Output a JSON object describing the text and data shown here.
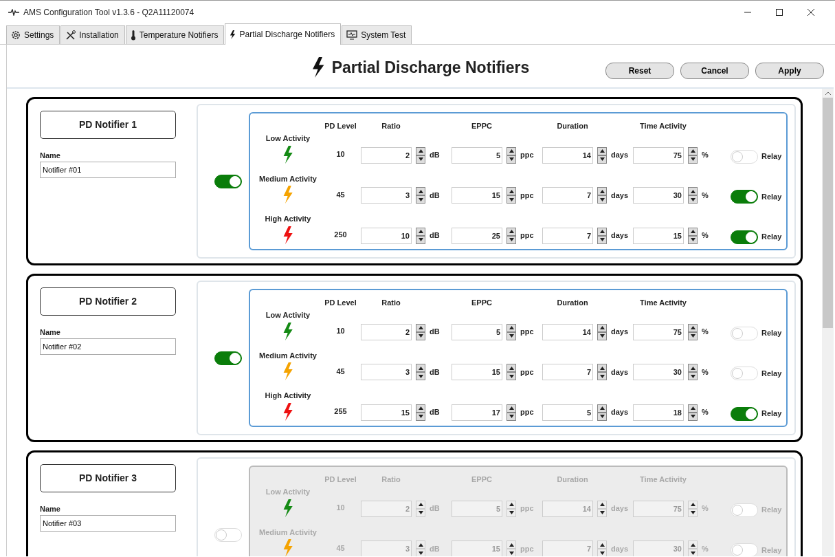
{
  "window": {
    "title": "AMS Configuration Tool v1.3.6 - Q2A11120074"
  },
  "tabs": [
    {
      "label": "Settings",
      "kind": "gear",
      "selected": false
    },
    {
      "label": "Installation",
      "kind": "tools",
      "selected": false
    },
    {
      "label": "Temperature Notifiers",
      "kind": "thermometer",
      "selected": false
    },
    {
      "label": "Partial Discharge Notifiers",
      "kind": "bolt",
      "selected": true
    },
    {
      "label": "System Test",
      "kind": "monitor",
      "selected": false
    }
  ],
  "page": {
    "title": "Partial Discharge Notifiers"
  },
  "buttons": [
    "Reset",
    "Cancel",
    "Apply"
  ],
  "notifiers": [
    {
      "title": "PD Notifier 1",
      "name_label": "Name",
      "name": "Notifier #01",
      "enabled": true,
      "columns": [
        "PD Level",
        "Ratio",
        "EPPC",
        "Duration",
        "Time Activity"
      ],
      "rows": [
        {
          "activity": "Low Activity",
          "color": "#148a14",
          "pd_level": "10",
          "ratio": "2",
          "ratio_unit": "dB",
          "eppc": "5",
          "eppc_unit": "ppc",
          "duration": "14",
          "duration_unit": "days",
          "time_activity": "75",
          "time_unit": "%",
          "relay": false,
          "relay_label": "Relay"
        },
        {
          "activity": "Medium Activity",
          "color": "#f5a300",
          "pd_level": "45",
          "ratio": "3",
          "ratio_unit": "dB",
          "eppc": "15",
          "eppc_unit": "ppc",
          "duration": "7",
          "duration_unit": "days",
          "time_activity": "30",
          "time_unit": "%",
          "relay": true,
          "relay_label": "Relay"
        },
        {
          "activity": "High Activity",
          "color": "#ee1111",
          "pd_level": "250",
          "ratio": "10",
          "ratio_unit": "dB",
          "eppc": "25",
          "eppc_unit": "ppc",
          "duration": "7",
          "duration_unit": "days",
          "time_activity": "15",
          "time_unit": "%",
          "relay": true,
          "relay_label": "Relay"
        }
      ]
    },
    {
      "title": "PD Notifier 2",
      "name_label": "Name",
      "name": "Notifier #02",
      "enabled": true,
      "columns": [
        "PD Level",
        "Ratio",
        "EPPC",
        "Duration",
        "Time Activity"
      ],
      "rows": [
        {
          "activity": "Low Activity",
          "color": "#148a14",
          "pd_level": "10",
          "ratio": "2",
          "ratio_unit": "dB",
          "eppc": "5",
          "eppc_unit": "ppc",
          "duration": "14",
          "duration_unit": "days",
          "time_activity": "75",
          "time_unit": "%",
          "relay": false,
          "relay_label": "Relay"
        },
        {
          "activity": "Medium Activity",
          "color": "#f5a300",
          "pd_level": "45",
          "ratio": "3",
          "ratio_unit": "dB",
          "eppc": "15",
          "eppc_unit": "ppc",
          "duration": "7",
          "duration_unit": "days",
          "time_activity": "30",
          "time_unit": "%",
          "relay": false,
          "relay_label": "Relay"
        },
        {
          "activity": "High Activity",
          "color": "#ee1111",
          "pd_level": "255",
          "ratio": "15",
          "ratio_unit": "dB",
          "eppc": "17",
          "eppc_unit": "ppc",
          "duration": "5",
          "duration_unit": "days",
          "time_activity": "18",
          "time_unit": "%",
          "relay": true,
          "relay_label": "Relay"
        }
      ]
    },
    {
      "title": "PD Notifier 3",
      "name_label": "Name",
      "name": "Notifier #03",
      "enabled": false,
      "columns": [
        "PD Level",
        "Ratio",
        "EPPC",
        "Duration",
        "Time Activity"
      ],
      "rows": [
        {
          "activity": "Low Activity",
          "color": "#148a14",
          "pd_level": "10",
          "ratio": "2",
          "ratio_unit": "dB",
          "eppc": "5",
          "eppc_unit": "ppc",
          "duration": "14",
          "duration_unit": "days",
          "time_activity": "75",
          "time_unit": "%",
          "relay": false,
          "relay_label": "Relay"
        },
        {
          "activity": "Medium Activity",
          "color": "#f5a300",
          "pd_level": "45",
          "ratio": "3",
          "ratio_unit": "dB",
          "eppc": "15",
          "eppc_unit": "ppc",
          "duration": "7",
          "duration_unit": "days",
          "time_activity": "30",
          "time_unit": "%",
          "relay": false,
          "relay_label": "Relay"
        }
      ]
    }
  ]
}
